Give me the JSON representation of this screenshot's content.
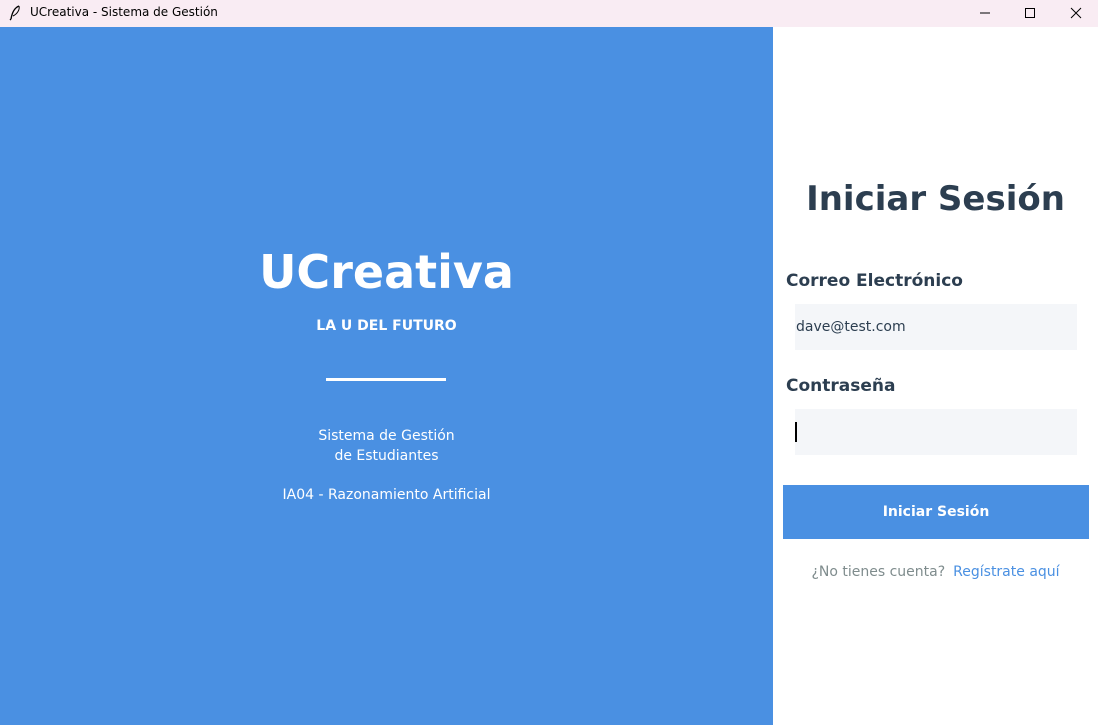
{
  "window": {
    "title": "UCreativa - Sistema de Gestión",
    "icon": "feather-icon",
    "controls": [
      "minimize-icon",
      "maximize-icon",
      "close-icon"
    ]
  },
  "left": {
    "brand": "UCreativa",
    "tagline": "LA U DEL FUTURO",
    "description_line1": "Sistema de Gestión",
    "description_line2": "de Estudiantes",
    "course": "IA04 - Razonamiento Artificial",
    "background_color": "#4a90e2"
  },
  "login": {
    "title": "Iniciar Sesión",
    "email_label": "Correo Electrónico",
    "email_value": "dave@test.com",
    "password_label": "Contraseña",
    "password_value": "",
    "submit_label": "Iniciar Sesión",
    "signup_question": "¿No tienes cuenta?",
    "signup_link": "Regístrate aquí",
    "accent_color": "#4a90e2",
    "text_color": "#2c3e50"
  }
}
